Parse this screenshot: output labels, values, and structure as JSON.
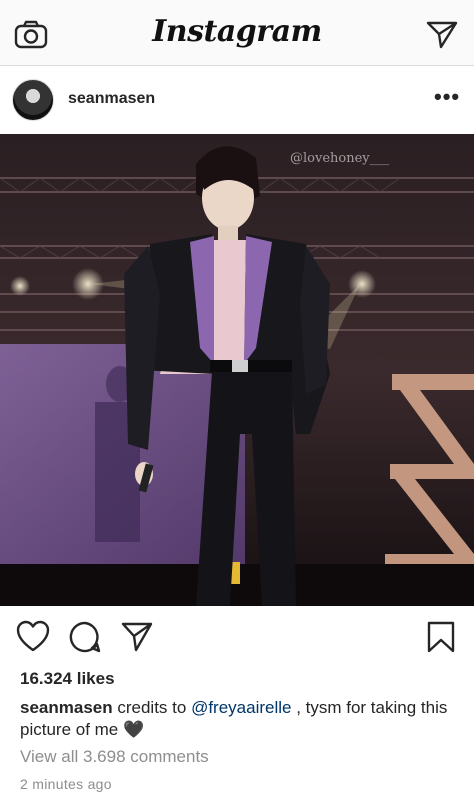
{
  "app": {
    "name": "Instagram"
  },
  "icons": {
    "camera": "camera-icon",
    "direct": "paper-plane-icon",
    "more": "more-icon",
    "like": "heart-icon",
    "comment": "comment-icon",
    "share": "share-icon",
    "save": "bookmark-icon"
  },
  "post": {
    "username": "seanmasen",
    "more_label": "•••",
    "watermark": "@lovehoney___",
    "likes": "16.324 likes",
    "caption": {
      "username": "seanmasen",
      "before_mention": "credits to ",
      "mention": "@freyaairelle",
      "after_mention": " , tysm for taking this picture of me 🖤"
    },
    "view_all_comments": "View all 3.698 comments",
    "timestamp": "2 minutes ago"
  },
  "colors": {
    "link": "#003569",
    "muted": "#8e8e8e",
    "text": "#262626",
    "accent_purple": "#7d5a9c"
  }
}
